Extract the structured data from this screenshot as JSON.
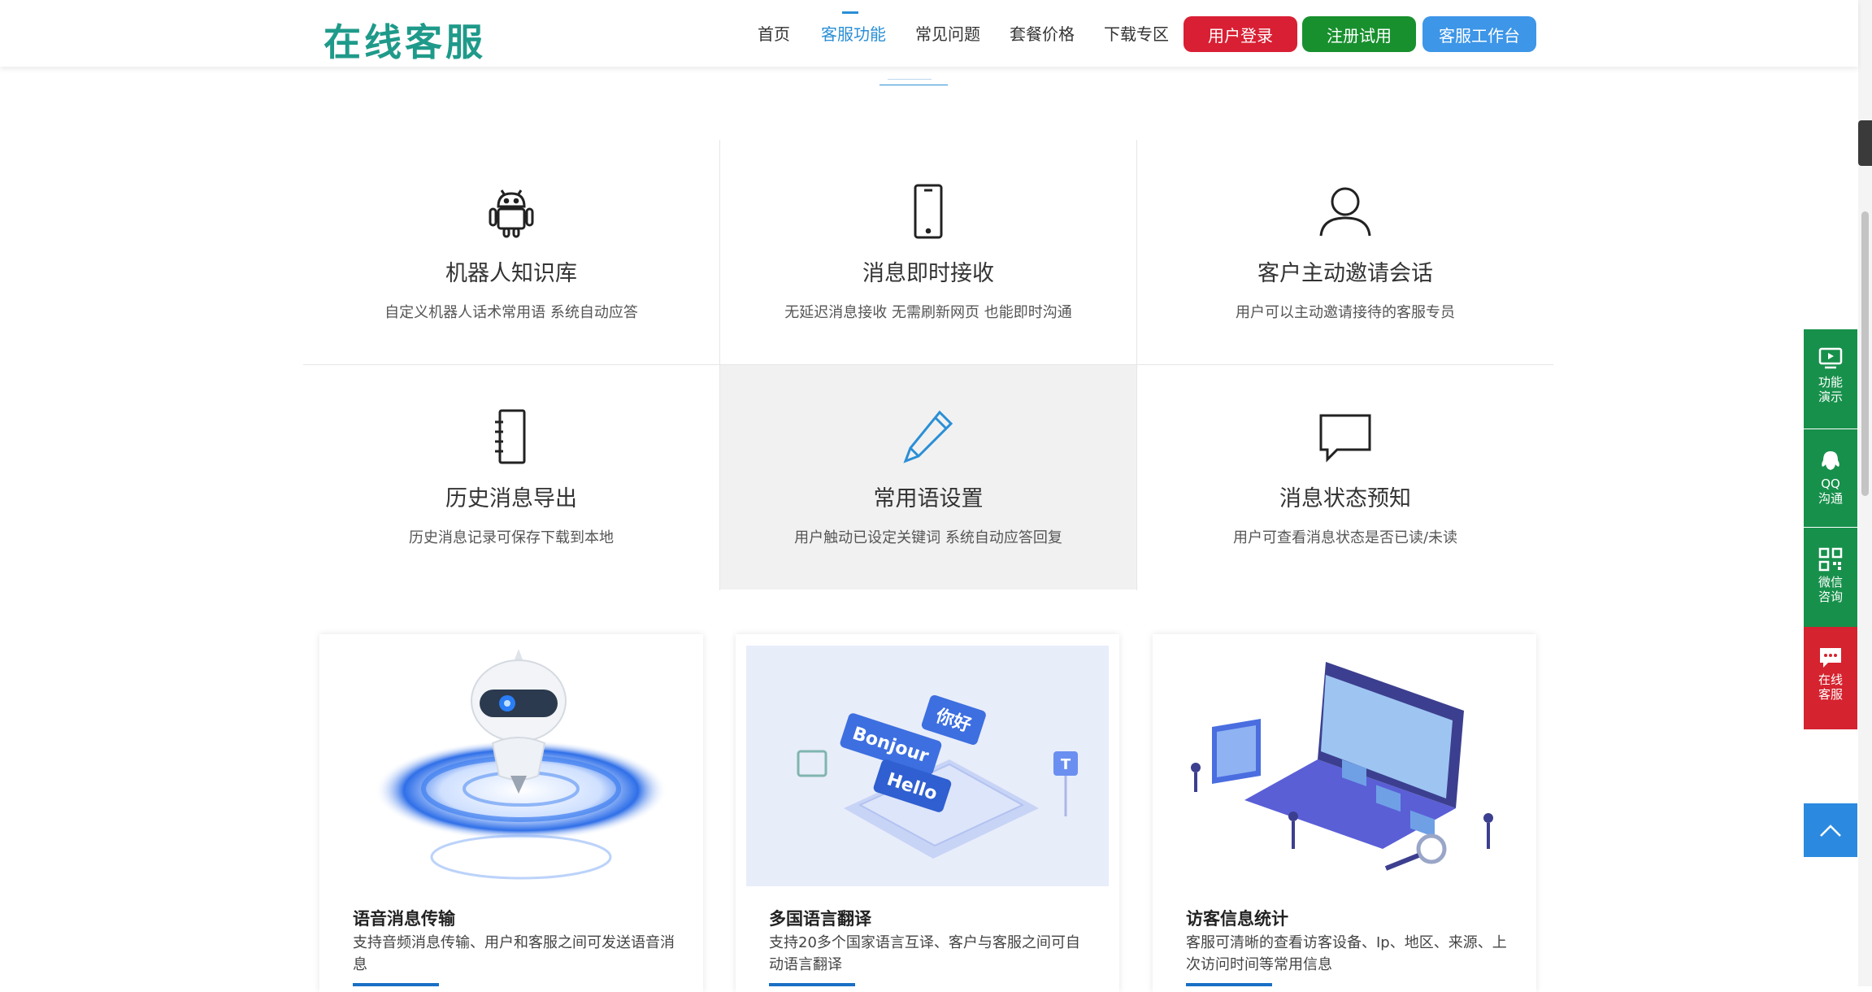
{
  "header": {
    "logo": "在线客服",
    "nav": [
      {
        "label": "首页",
        "active": false
      },
      {
        "label": "客服功能",
        "active": true
      },
      {
        "label": "常见问题",
        "active": false
      },
      {
        "label": "套餐价格",
        "active": false
      },
      {
        "label": "下载专区",
        "active": false
      }
    ],
    "buttons": {
      "login": "用户登录",
      "register": "注册试用",
      "workbench": "客服工作台"
    }
  },
  "features": [
    {
      "icon": "android-icon",
      "title": "机器人知识库",
      "desc": "自定义机器人话术常用语 系统自动应答"
    },
    {
      "icon": "phone-icon",
      "title": "消息即时接收",
      "desc": "无延迟消息接收 无需刷新网页 也能即时沟通"
    },
    {
      "icon": "user-icon",
      "title": "客户主动邀请会话",
      "desc": "用户可以主动邀请接待的客服专员"
    },
    {
      "icon": "notebook-icon",
      "title": "历史消息导出",
      "desc": "历史消息记录可保存下载到本地"
    },
    {
      "icon": "pencil-icon",
      "title": "常用语设置",
      "desc": "用户触动已设定关键词 系统自动应答回复"
    },
    {
      "icon": "chat-bubble-icon",
      "title": "消息状态预知",
      "desc": "用户可查看消息状态是否已读/未读"
    }
  ],
  "cards": [
    {
      "title": "语音消息传输",
      "desc": "支持音频消息传输、用户和客服之间可发送语音消息",
      "image_text": []
    },
    {
      "title": "多国语言翻译",
      "desc": "支持20多个国家语言互译、客户与客服之间可自动语言翻译",
      "image_text": [
        "Bonjour",
        "你好",
        "Hello",
        "T"
      ]
    },
    {
      "title": "访客信息统计",
      "desc": "客服可清晰的查看访客设备、Ip、地区、来源、上次访问时间等常用信息",
      "image_text": []
    }
  ],
  "float_bar": {
    "items": [
      {
        "icon": "play-screen-icon",
        "label": "功能演示"
      },
      {
        "icon": "qq-icon",
        "label": "QQ沟通"
      },
      {
        "icon": "qrcode-icon",
        "label": "微信咨询"
      },
      {
        "icon": "message-icon",
        "label": "在线客服"
      }
    ]
  },
  "colors": {
    "accent": "#2a8fd6",
    "login": "#d91f33",
    "register": "#18902e",
    "workbench": "#3d96e8",
    "float_green": "#17904b",
    "float_red": "#d5232f",
    "logo": "#1f9a8a"
  }
}
